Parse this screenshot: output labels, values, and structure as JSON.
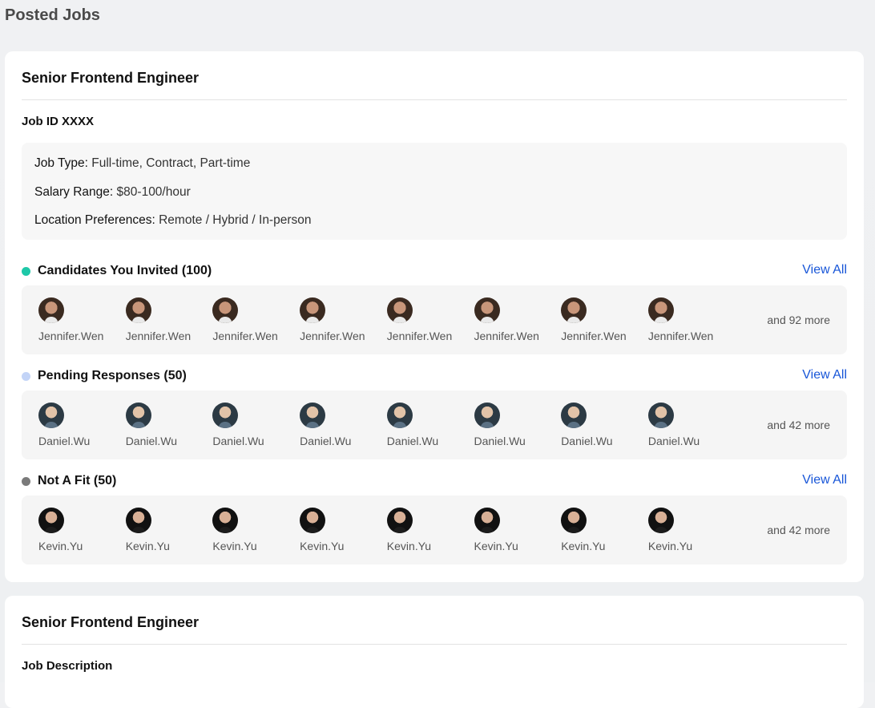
{
  "page": {
    "title": "Posted Jobs"
  },
  "jobs": [
    {
      "title": "Senior Frontend Engineer",
      "subheading": "Job ID XXXX",
      "details": [
        {
          "key": "Job Type:",
          "value": "Full-time, Contract, Part-time"
        },
        {
          "key": "Salary Range:",
          "value": "$80-100/hour"
        },
        {
          "key": "Location Preferences:",
          "value": "Remote / Hybrid / In-person"
        }
      ],
      "sections": [
        {
          "label": "Candidates You Invited (100)",
          "dot_color": "#1ec8a8",
          "view_all": "View All",
          "avatar": "avatar-icon",
          "people": [
            "Jennifer.Wen",
            "Jennifer.Wen",
            "Jennifer.Wen",
            "Jennifer.Wen",
            "Jennifer.Wen",
            "Jennifer.Wen",
            "Jennifer.Wen",
            "Jennifer.Wen"
          ],
          "more": "and 92 more"
        },
        {
          "label": "Pending Responses (50)",
          "dot_color": "#c3d4f7",
          "view_all": "View All",
          "avatar": "avatar-icon",
          "people": [
            "Daniel.Wu",
            "Daniel.Wu",
            "Daniel.Wu",
            "Daniel.Wu",
            "Daniel.Wu",
            "Daniel.Wu",
            "Daniel.Wu",
            "Daniel.Wu"
          ],
          "more": "and 42 more"
        },
        {
          "label": "Not A Fit (50)",
          "dot_color": "#7a7a7a",
          "view_all": "View All",
          "avatar": "avatar-icon",
          "people": [
            "Kevin.Yu",
            "Kevin.Yu",
            "Kevin.Yu",
            "Kevin.Yu",
            "Kevin.Yu",
            "Kevin.Yu",
            "Kevin.Yu",
            "Kevin.Yu"
          ],
          "more": "and 42 more"
        }
      ]
    },
    {
      "title": "Senior Frontend Engineer",
      "subheading": "Job Description"
    }
  ],
  "colors": {
    "link": "#1856d8"
  }
}
